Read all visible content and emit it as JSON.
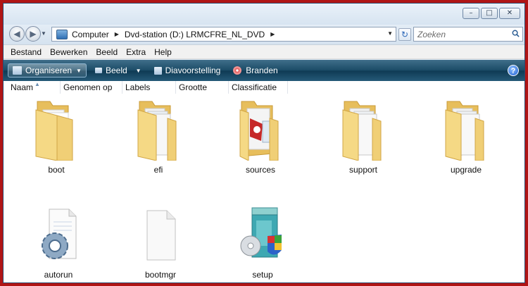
{
  "window": {
    "buttons": {
      "minimize": "–",
      "maximize": "□",
      "close": "✕"
    }
  },
  "nav": {
    "back_icon": "back-arrow-icon",
    "forward_icon": "forward-arrow-icon",
    "breadcrumbs": [
      "Computer",
      "Dvd-station (D:) LRMCFRE_NL_DVD"
    ],
    "search_placeholder": "Zoeken"
  },
  "menu": [
    "Bestand",
    "Bewerken",
    "Beeld",
    "Extra",
    "Help"
  ],
  "toolbar": {
    "organise": "Organiseren",
    "view": "Beeld",
    "slideshow": "Diavoorstelling",
    "burn": "Branden",
    "help": "?"
  },
  "columns": [
    "Naam",
    "Genomen op",
    "Labels",
    "Grootte",
    "Classificatie"
  ],
  "items": [
    {
      "name": "boot",
      "type": "folder"
    },
    {
      "name": "efi",
      "type": "folder"
    },
    {
      "name": "sources",
      "type": "folder"
    },
    {
      "name": "support",
      "type": "folder"
    },
    {
      "name": "upgrade",
      "type": "folder"
    },
    {
      "name": "autorun",
      "type": "settings-file"
    },
    {
      "name": "bootmgr",
      "type": "blank-file"
    },
    {
      "name": "setup",
      "type": "installer"
    }
  ],
  "colors": {
    "frame": "#b01515",
    "command_bar": "#1b4b66",
    "folder": "#f2d27a"
  }
}
